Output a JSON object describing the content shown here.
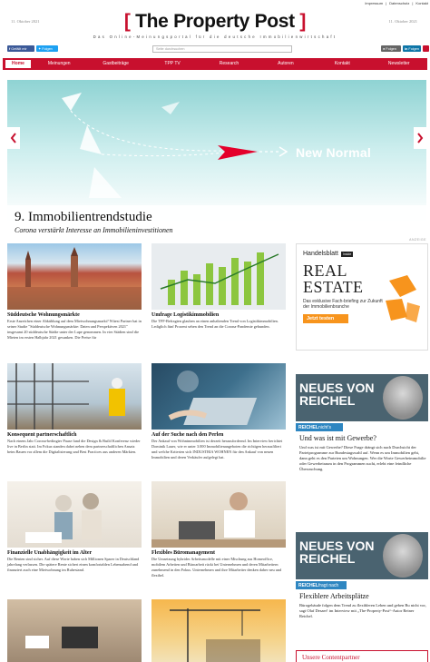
{
  "top_links": [
    "Impressum",
    "Datenschutz",
    "Kontakt"
  ],
  "masthead": {
    "date_left": "11. Oktober 2021",
    "date_right": "11. Oktober 2021",
    "logo_text": "The Property Post",
    "tagline": "Das Online-Meinungsportal für die deutsche Immobilienwirtschaft"
  },
  "social": {
    "facebook": "Gefällt mir",
    "twitter": "Folgen",
    "search_placeholder": "Seite durchsuchen",
    "folgen1": "Folgen",
    "folgen2": "Folgen"
  },
  "nav": [
    "Home",
    "Meinungen",
    "Gastbeiträge",
    "TPP TV",
    "Research",
    "Autoren",
    "Kontakt",
    "Newsletter"
  ],
  "hero": {
    "overlay_text": "New Normal",
    "title": "9. Immobilientrendstudie",
    "subtitle": "Corona verstärkt Interesse an Immobilieninvestitionen"
  },
  "anzeige": "ANZEIGE",
  "articles": [
    {
      "title": "Süddeutsche Wohnungsmärkte",
      "text": "Erste Anzeichen einer Abkühlung auf dem Mietwohnungsmarkt? Wüest Partner hat in seiner Studie \"Süddeutsche Wohnungsmärkte: Daten und Perspektiven 2021\" insgesamt 20 süddeutsche Städte unter der Lupe genommen. In vier Städten sind die Mieten im ersten Halbjahr 2021 gesunken. Die Preise für"
    },
    {
      "title": "Umfrage Logistikimmobilien",
      "text": "Die TFF-Befragten glauben an einen anhaltenden Trend von Logistikimmobilien. Lediglich fünf Prozent sehen den Trend an die Corona-Pandemie gebunden."
    },
    {
      "title": "Konsequent partnerschaftlich",
      "text": "Nach einem Jahr Corona-bedingter Pause fand die Design & Build Konferenz wieder live in Berlin statt. Im Fokus standen dabei neben dem partnerschaftlichen Ansatz beim Bauen vor allem die Digitalisierung und Best Practices aus anderen Märkten."
    },
    {
      "title": "Auf der Suche nach den Perlen",
      "text": "Der Ankauf von Wohnimmobilien ist derzeit herausfordernd. Im Interview berichtet Dominik Lauer, wie er unter 3.000 Immobilienangeboten die richtigen herausfiltert und welche Kriterien sich INDUSTRIA WOHNEN für den Ankauf von neuen Immobilien und deren Verkäufer aufgelegt hat."
    },
    {
      "title": "Finanzielle Unabhängigkeit im Alter",
      "text": "Die Renten sind sicher. Auf diese Worte haben sich Millionen Sparer in Deutschland jahrelang verlassen. Die spätere Rente sichert einen komfortablen Lebensabend und finanziert auch eine Mietwohnung im Ruhestand."
    },
    {
      "title": "Flexibles Büromanagement",
      "text": "Die Umsetzung hybrider Arbeitsmodelle mit einer Mischung aus Homeoffice, mobilem Arbeiten und Büroarbeit rückt bei Unternehmen und deren Mitarbeitern zunehmend in den Fokus. Unternehmen und ihre Mitarbeiter denken daher neu und flexibel."
    }
  ],
  "ad_handelsblatt": {
    "brand": "Handelsblatt",
    "inside": "Inside",
    "headline_line1": "REAL",
    "headline_line2": "ESTATE",
    "text": "Das exklusive Fach-briefing zur Zukunft der Immobilienbranche",
    "cta": "Jetzt testen"
  },
  "reichel_1": {
    "title_line1": "NEUES VON",
    "title_line2": "REICHEL",
    "label_bold": "REICHEL",
    "label_rest": "nicht's",
    "headline": "Und was ist mit Gewerbe?",
    "text": "Und was ist mit Gewerbe? Diese Frage drängt sich nach Durchsicht der Parteiprogramme zur Bundestagswahl auf. Wenn es um Immobilien geht, dann geht es den Parteien um Wohnungen. Wer die Worte Gewerbeimmobilie oder Gewerbeiraum in den Programmen sucht, erlebt eine feindliche Überraschung."
  },
  "reichel_2": {
    "title_line1": "NEUES VON",
    "title_line2": "REICHEL",
    "label_bold": "REICHEL",
    "label_rest": "fragt nach",
    "headline": "Flexiblere Arbeitsplätze",
    "text": "Bürogebäude folgen dem Trend zu flexibleren Leben und geben Bu nicht vor, sagt Olaf Desaer! im Interview mit „The-Property-Post“-Autor Reiner Reichel."
  },
  "partner": {
    "title": "Unsere Contentpartner"
  }
}
